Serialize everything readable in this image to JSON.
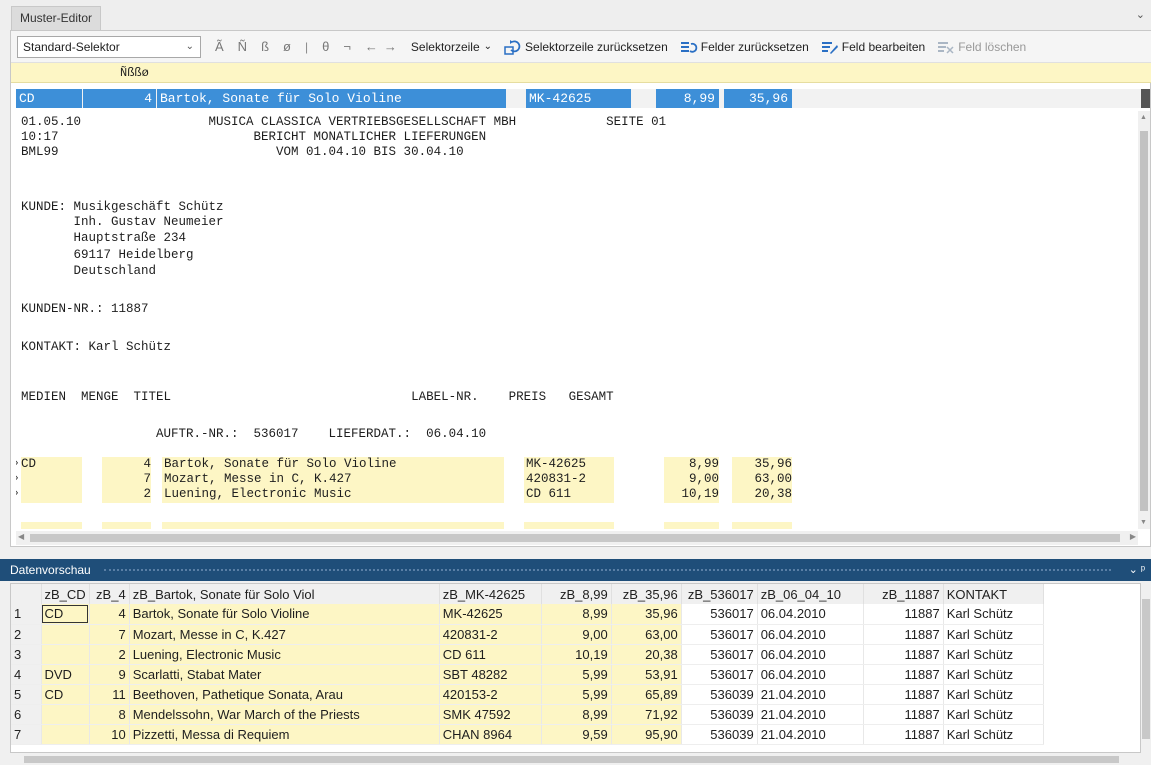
{
  "tab": {
    "title": "Muster-Editor"
  },
  "toolbar": {
    "selector_value": "Standard-Selektor",
    "chars": [
      "Ã",
      "Ñ",
      "ß",
      "ø",
      "|",
      "θ",
      "¬",
      "←",
      "→"
    ],
    "selektorzeile_label": "Selektorzeile",
    "reset_selector_label": "Selektorzeile zurücksetzen",
    "reset_fields_label": "Felder zurücksetzen",
    "edit_field_label": "Feld bearbeiten",
    "delete_field_label": "Feld löschen"
  },
  "char_band": "Ñßßø",
  "selector_row": {
    "cells": [
      "CD",
      "4",
      "Bartok, Sonate für Solo Violine",
      "MK-42625",
      "8,99",
      "35,96"
    ]
  },
  "report": {
    "header_lines": [
      "01.05.10                 MUSICA CLASSICA VERTRIEBSGESELLSCHAFT MBH            SEITE 01",
      "10:17                          BERICHT MONATLICHER LIEFERUNGEN",
      "BML99                             VOM 01.04.10 BIS 30.04.10"
    ],
    "customer_lines": [
      "KUNDE: Musikgeschäft Schütz",
      "       Inh. Gustav Neumeier",
      "       Hauptstraße 234",
      "       69117 Heidelberg",
      "       Deutschland"
    ],
    "kunden_nr": "KUNDEN-NR.: 11887",
    "kontakt": "KONTAKT: Karl Schütz",
    "columns_line": "MEDIEN  MENGE  TITEL                                LABEL-NR.    PREIS   GESAMT",
    "order_line": "                  AUFTR.-NR.:  536017    LIEFERDAT.:  06.04.10",
    "items": [
      {
        "medien": "CD",
        "menge": "4",
        "titel": "Bartok, Sonate für Solo Violine",
        "label": "MK-42625",
        "preis": "8,99",
        "gesamt": "35,96"
      },
      {
        "medien": "",
        "menge": "7",
        "titel": "Mozart, Messe in C, K.427",
        "label": "420831-2",
        "preis": "9,00",
        "gesamt": "63,00"
      },
      {
        "medien": "",
        "menge": "2",
        "titel": "Luening, Electronic Music",
        "label": "CD 611",
        "preis": "10,19",
        "gesamt": "20,38"
      }
    ],
    "marker": "»"
  },
  "data_preview": {
    "title": "Datenvorschau",
    "controls": "⌄ ᵖ",
    "columns": [
      "",
      "zB_CD",
      "zB_4",
      "zB_Bartok, Sonate für Solo Viol",
      "zB_MK-42625",
      "zB_8,99",
      "zB_35,96",
      "zB_536017",
      "zB_06_04_10",
      "zB_11887",
      "KONTAKT"
    ],
    "rows": [
      [
        "1",
        "CD",
        "4",
        "Bartok, Sonate für Solo Violine",
        "MK-42625",
        "8,99",
        "35,96",
        "536017",
        "06.04.2010",
        "11887",
        "Karl Schütz"
      ],
      [
        "2",
        "",
        "7",
        "Mozart, Messe in C, K.427",
        "420831-2",
        "9,00",
        "63,00",
        "536017",
        "06.04.2010",
        "11887",
        "Karl Schütz"
      ],
      [
        "3",
        "",
        "2",
        "Luening, Electronic Music",
        "CD 611",
        "10,19",
        "20,38",
        "536017",
        "06.04.2010",
        "11887",
        "Karl Schütz"
      ],
      [
        "4",
        "DVD",
        "9",
        "Scarlatti, Stabat Mater",
        "SBT 48282",
        "5,99",
        "53,91",
        "536017",
        "06.04.2010",
        "11887",
        "Karl Schütz"
      ],
      [
        "5",
        "CD",
        "11",
        "Beethoven, Pathetique Sonata, Arau",
        "420153-2",
        "5,99",
        "65,89",
        "536039",
        "21.04.2010",
        "11887",
        "Karl Schütz"
      ],
      [
        "6",
        "",
        "8",
        "Mendelssohn, War March of the Priests",
        "SMK 47592",
        "8,99",
        "71,92",
        "536039",
        "21.04.2010",
        "11887",
        "Karl Schütz"
      ],
      [
        "7",
        "",
        "10",
        "Pizzetti, Messa di Requiem",
        "CHAN 8964",
        "9,59",
        "95,90",
        "536039",
        "21.04.2010",
        "11887",
        "Karl Schütz"
      ]
    ]
  },
  "colors": {
    "highlight": "#fdf6c5",
    "selection": "#3d8fd8",
    "panel_header": "#1f4e79"
  }
}
